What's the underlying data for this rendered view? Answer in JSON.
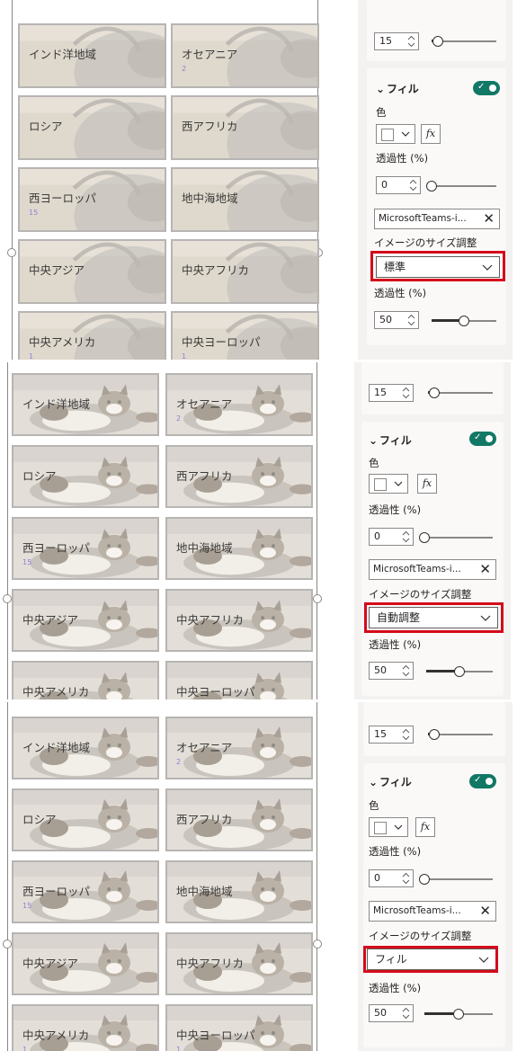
{
  "tiles": [
    {
      "label": "インド洋地域",
      "count": ""
    },
    {
      "label": "オセアニア",
      "count": "2"
    },
    {
      "label": "ロシア",
      "count": ""
    },
    {
      "label": "西アフリカ",
      "count": ""
    },
    {
      "label": "西ヨーロッパ",
      "count": "15"
    },
    {
      "label": "地中海地域",
      "count": ""
    },
    {
      "label": "中央アジア",
      "count": ""
    },
    {
      "label": "中央アフリカ",
      "count": ""
    },
    {
      "label": "中央アメリカ",
      "count": "1"
    },
    {
      "label": "中央ヨーロッパ",
      "count": "1"
    }
  ],
  "panel": {
    "top_value": "15",
    "fill_header": "フィル",
    "color_label": "色",
    "fx_label": "fx",
    "transparency_label": "透過性 (%)",
    "fill_transparency": "0",
    "image_file": "MicrosoftTeams-i...",
    "image_size_label": "イメージのサイズ調整",
    "image_transparency": "50"
  },
  "screens": [
    {
      "image_size_value": "標準"
    },
    {
      "image_size_value": "自動調整"
    },
    {
      "image_size_value": "フィル"
    }
  ],
  "sliders": {
    "top_level": 0.1,
    "fill_transparency_level": 0.0,
    "image_transparency_level": 0.5
  },
  "colors": {
    "accent_red": "#d40b1a",
    "toggle_on": "#117865",
    "panel_bg": "#f3f2f1",
    "count_purple": "#8c82d6"
  }
}
